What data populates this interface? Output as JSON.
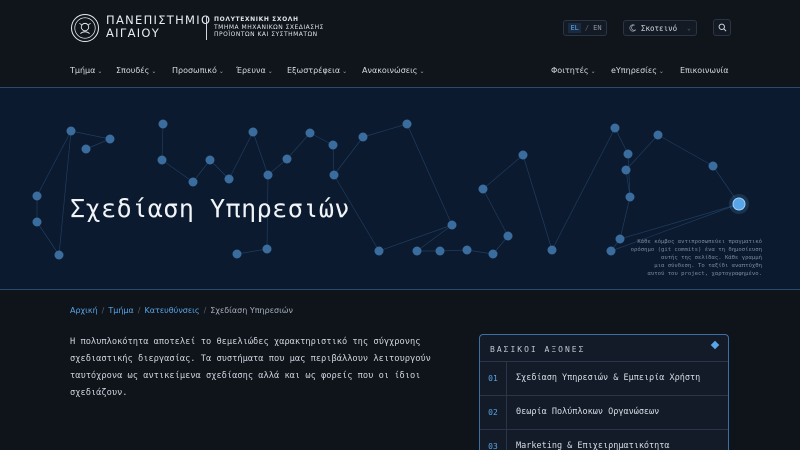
{
  "header": {
    "university_name_line1": "ΠΑΝΕΠΙΣΤΗΜΙΟ",
    "university_name_line2": "ΑΙΓΑΙΟΥ",
    "school_title": "ΠΟΛΥΤΕΧΝΙΚΗ ΣΧΟΛΗ",
    "department_line1": "ΤΜΗΜΑ ΜΗΧΑΝΙΚΩΝ ΣΧΕΔΙΑΣΗΣ",
    "department_line2": "ΠΡΟΪΟΝΤΩΝ ΚΑΙ ΣΥΣΤΗΜΑΤΩΝ",
    "lang_active": "EL",
    "lang_separator": "/",
    "lang_inactive": "EN",
    "theme_label": "Σκοτεινό",
    "logo_icon": "university-seal-icon"
  },
  "nav": {
    "left": [
      {
        "label": "Τμήμα",
        "has_dropdown": true
      },
      {
        "label": "Σπουδές",
        "has_dropdown": true
      },
      {
        "label": "Προσωπικό",
        "has_dropdown": true
      },
      {
        "label": "Έρευνα",
        "has_dropdown": true
      },
      {
        "label": "Εξωστρέφεια",
        "has_dropdown": true
      },
      {
        "label": "Ανακοινώσεις",
        "has_dropdown": true
      }
    ],
    "right": [
      {
        "label": "Φοιτητές",
        "has_dropdown": true
      },
      {
        "label": "eΥπηρεσίες",
        "has_dropdown": true
      },
      {
        "label": "Επικοινωνία",
        "has_dropdown": false
      }
    ]
  },
  "hero": {
    "title": "Σχεδίαση Υπηρεσιών",
    "caption_lines": [
      "Κάθε κόμβος αντιπροσωπεύει πραγματικό",
      "ορόσημο (git commits) ένα τη δημοσίευση",
      "αυτής της σελίδας. Κάθε γραμμή",
      "μια σύνδεση. Το ταξίδι αναπτύχθη",
      "αυτού του project, χαρτογραφημένο."
    ]
  },
  "breadcrumb": {
    "items": [
      "Αρχική",
      "Τμήμα",
      "Κατευθύνσεις"
    ],
    "current": "Σχεδίαση Υπηρεσιών",
    "separator": "/"
  },
  "intro": {
    "text": "Η πολυπλοκότητα αποτελεί το θεμελιώδες χαρακτηριστικό της σύγχρονης σχεδιαστικής διεργασίας. Τα συστήματα που μας περιβάλλουν λειτουργούν ταυτόχρονα ως αντικείμενα σχεδίασης αλλά και ως φορείς που οι ίδιοι σχεδιάζουν."
  },
  "axes": {
    "title": "ΒΑΣΙΚΟΙ ΑΞΟΝΕΣ",
    "items": [
      {
        "num": "01",
        "label": "Σχεδίαση Υπηρεσιών & Εμπειρία Χρήστη"
      },
      {
        "num": "02",
        "label": "Θεωρία Πολύπλοκων Οργανώσεων"
      },
      {
        "num": "03",
        "label": "Marketing & Επιχειρηματικότητα"
      }
    ]
  },
  "colors": {
    "accent": "#58a6e8",
    "background": "#0f131a",
    "hero_background": "#0b1a2e",
    "node": "#3a6d9e",
    "highlight_node": "#58a6e8"
  }
}
